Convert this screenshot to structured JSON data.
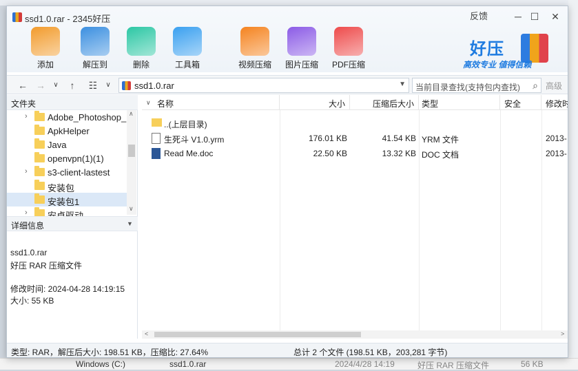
{
  "window": {
    "title": "ssd1.0.rar - 2345好压",
    "feedback": "反馈",
    "minimize": "─",
    "maximize": "☐",
    "close": "✕"
  },
  "toolbar": [
    {
      "label": "添加",
      "icon": "add-icon",
      "color": "#f29b2c"
    },
    {
      "label": "解压到",
      "icon": "extract-icon",
      "color": "#3b8fe0"
    },
    {
      "label": "删除",
      "icon": "recycle-icon",
      "color": "#2cc7a4"
    },
    {
      "label": "工具箱",
      "icon": "toolbox-icon",
      "color": "#3aa0f0"
    },
    {
      "label": "视频压缩",
      "icon": "video-compress-icon",
      "color": "#f5831f"
    },
    {
      "label": "图片压缩",
      "icon": "image-compress-icon",
      "color": "#8b5be6"
    },
    {
      "label": "PDF压缩",
      "icon": "pdf-compress-icon",
      "color": "#ee4b4b"
    }
  ],
  "brand": {
    "name": "好压",
    "slogan": "高效专业  値得信赖"
  },
  "address": {
    "path": "ssd1.0.rar",
    "search_placeholder": "当前目录查找(支持包内查找)",
    "advanced": "高级"
  },
  "left": {
    "folder_header": "文件夹",
    "tree": [
      {
        "label": "Adobe_Photoshop_",
        "expand": true
      },
      {
        "label": "ApkHelper",
        "expand": false
      },
      {
        "label": "Java",
        "expand": false
      },
      {
        "label": "openvpn(1)(1)",
        "expand": false
      },
      {
        "label": "s3-client-lastest",
        "expand": true
      },
      {
        "label": "安装包",
        "expand": false
      },
      {
        "label": "安装包1",
        "expand": false,
        "selected": true
      },
      {
        "label": "安卓驱动",
        "expand": true
      }
    ],
    "details_header": "详细信息",
    "details": {
      "filename": "ssd1.0.rar",
      "type": "好压 RAR 压缩文件",
      "modified": "修改时间: 2024-04-28 14:19:15",
      "size": "大小: 55 KB"
    }
  },
  "list": {
    "headers": {
      "name": "名称",
      "size": "大小",
      "packed": "压缩后大小",
      "type": "类型",
      "security": "安全",
      "modified": "修改时"
    },
    "rows": [
      {
        "name": "..(上层目录)",
        "size": "",
        "packed": "",
        "type": "",
        "modified": "",
        "icon": "folder-up-icon"
      },
      {
        "name": "生死斗 V1.0.yrm",
        "size": "176.01 KB",
        "packed": "41.54 KB",
        "type": "YRM 文件",
        "modified": "2013-",
        "icon": "file-icon"
      },
      {
        "name": "Read Me.doc",
        "size": "22.50 KB",
        "packed": "13.32 KB",
        "type": "DOC 文档",
        "modified": "2013-",
        "icon": "word-doc-icon"
      }
    ]
  },
  "status": {
    "left": "类型: RAR，解压后大小: 198.51 KB，压缩比: 27.64%",
    "right": "总计 2 个文件 (198.51 KB，203,281 字节)"
  },
  "background": {
    "drive": "Windows (C:)",
    "file_name": "ssd1.0.rar",
    "file_date": "2024/4/28 14:19",
    "file_type": "好压 RAR 压缩文件",
    "file_size": "56 KB",
    "top_path": "安装包1"
  }
}
